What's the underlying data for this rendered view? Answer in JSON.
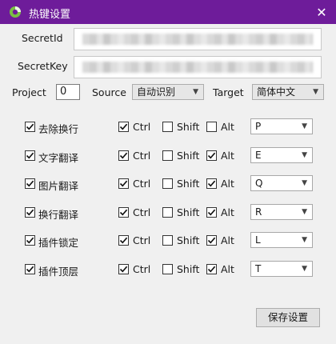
{
  "window": {
    "title": "热键设置",
    "close_glyph": "✕"
  },
  "credentials": {
    "secret_id_label": "SecretId",
    "secret_key_label": "SecretKey"
  },
  "options": {
    "project_label": "Project",
    "project_value": "0",
    "source_label": "Source",
    "source_value": "自动识别",
    "target_label": "Target",
    "target_value": "简体中文"
  },
  "modifier_labels": {
    "ctrl": "Ctrl",
    "shift": "Shift",
    "alt": "Alt"
  },
  "hotkeys": [
    {
      "label": "去除换行",
      "enabled": true,
      "ctrl": true,
      "shift": false,
      "alt": false,
      "key": "P"
    },
    {
      "label": "文字翻译",
      "enabled": true,
      "ctrl": true,
      "shift": false,
      "alt": true,
      "key": "E"
    },
    {
      "label": "图片翻译",
      "enabled": true,
      "ctrl": true,
      "shift": false,
      "alt": true,
      "key": "Q"
    },
    {
      "label": "换行翻译",
      "enabled": true,
      "ctrl": true,
      "shift": false,
      "alt": true,
      "key": "R"
    },
    {
      "label": "插件锁定",
      "enabled": true,
      "ctrl": true,
      "shift": false,
      "alt": true,
      "key": "L"
    },
    {
      "label": "插件顶层",
      "enabled": true,
      "ctrl": true,
      "shift": false,
      "alt": true,
      "key": "T"
    }
  ],
  "save_button_label": "保存设置",
  "colors": {
    "titlebar": "#6e1c9a",
    "icon_green": "#7ac143"
  }
}
